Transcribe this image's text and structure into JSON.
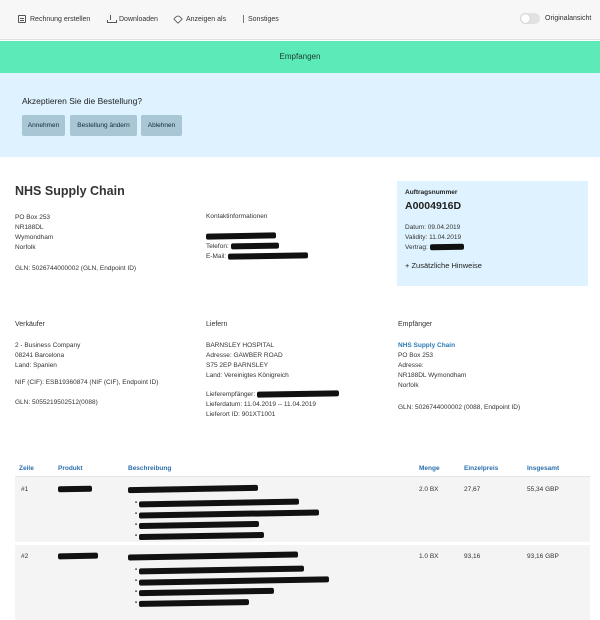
{
  "toolbar": {
    "items": [
      {
        "label": "Rechnung erstellen",
        "icon": "document-icon"
      },
      {
        "label": "Downloaden",
        "icon": "download-icon"
      },
      {
        "label": "Anzeigen als",
        "icon": "tag-icon"
      },
      {
        "label": "Sonstiges",
        "icon": "more-icon"
      }
    ],
    "toggle_label": "Originalansicht"
  },
  "status": {
    "label": "Empfangen",
    "color": "#5cebb8"
  },
  "accept": {
    "question": "Akzeptieren Sie die Bestellung?",
    "buttons": [
      "Annehmen",
      "Bestellung ändern",
      "Ablehnen"
    ]
  },
  "sender": {
    "name": "NHS Supply Chain",
    "address": [
      "PO Box 253",
      "NR188DL",
      "Wymondham",
      "Norfolk"
    ],
    "gln": "GLN: 5026744000002 (GLN, Endpoint ID)"
  },
  "contact": {
    "title": "Kontaktinformationen",
    "phone_label": "Telefon:",
    "email_label": "E-Mail:"
  },
  "order": {
    "label": "Auftragsnummer",
    "number": "A0004916D",
    "date": "Datum: 09.04.2019",
    "validity": "Validity: 11.04.2019",
    "contract_label": "Vertrag:",
    "notes_link": "+ Zusätzliche Hinweise"
  },
  "seller": {
    "title": "Verkäufer",
    "lines": [
      "2 - Business Company",
      "08241 Barcelona",
      "Land: Spanien"
    ],
    "nif": "NIF (CIF): ESB19360874 (NIF (CIF), Endpoint ID)",
    "gln": "GLN: 5055219502512(0088)"
  },
  "delivery": {
    "title": "Liefern",
    "lines": [
      "BARNSLEY HOSPITAL",
      "Adresse: GAWBER ROAD",
      "S75 2EP BARNSLEY",
      "Land: Vereinigtes Königreich"
    ],
    "recipient_label": "Lieferempfänger:",
    "date": "Lieferdatum: 11.04.2019 -- 11.04.2019",
    "ort": "Lieferort ID: 901XT1001"
  },
  "receiver": {
    "title": "Empfänger",
    "name": "NHS Supply Chain",
    "lines": [
      "PO Box 253",
      "Adresse:",
      "NR188DL Wymondham",
      "Norfolk"
    ],
    "gln": "GLN: 5026744000002 (0088, Endpoint ID)"
  },
  "table": {
    "headers": {
      "zeile": "Zeile",
      "produkt": "Produkt",
      "beschreibung": "Beschreibung",
      "menge": "Menge",
      "einzelpreis": "Einzelpreis",
      "gesamt": "Insgesamt"
    },
    "rows": [
      {
        "zeile": "#1",
        "menge": "2.0 BX",
        "einzelpreis": "27,67",
        "gesamt": "55,34 GBP"
      },
      {
        "zeile": "#2",
        "menge": "1.0 BX",
        "einzelpreis": "93,16",
        "gesamt": "93,16 GBP"
      }
    ]
  }
}
